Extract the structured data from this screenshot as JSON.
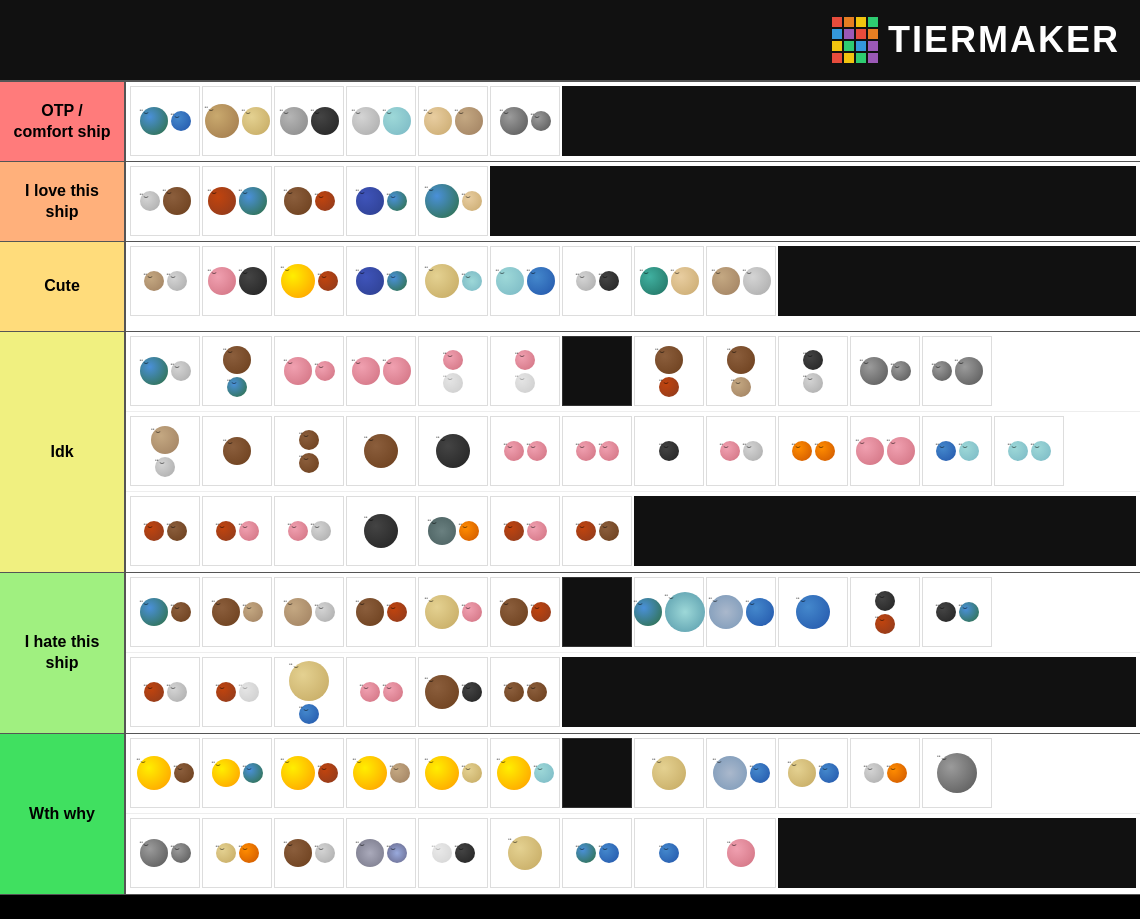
{
  "header": {
    "logo_text": "TiERMAKER"
  },
  "tiers": [
    {
      "id": "otp",
      "label": "OTP /\ncomfort ship",
      "color": "#ff7b7b",
      "rows": 1
    },
    {
      "id": "love",
      "label": "I love this\nship",
      "color": "#ffb07b",
      "rows": 1
    },
    {
      "id": "cute",
      "label": "Cute",
      "color": "#ffdc7b",
      "rows": 1
    },
    {
      "id": "idk",
      "label": "Idk",
      "color": "#f0f080",
      "rows": 3
    },
    {
      "id": "hate",
      "label": "I hate this\nship",
      "color": "#a0f080",
      "rows": 2
    },
    {
      "id": "wth",
      "label": "Wth why",
      "color": "#40e060",
      "rows": 2
    }
  ],
  "logo_colors": [
    "#e74c3c",
    "#e67e22",
    "#f1c40f",
    "#2ecc71",
    "#3498db",
    "#9b59b6",
    "#e74c3c",
    "#e67e22",
    "#f1c40f",
    "#2ecc71",
    "#3498db",
    "#9b59b6",
    "#e74c3c",
    "#f1c40f",
    "#2ecc71",
    "#9b59b6"
  ]
}
